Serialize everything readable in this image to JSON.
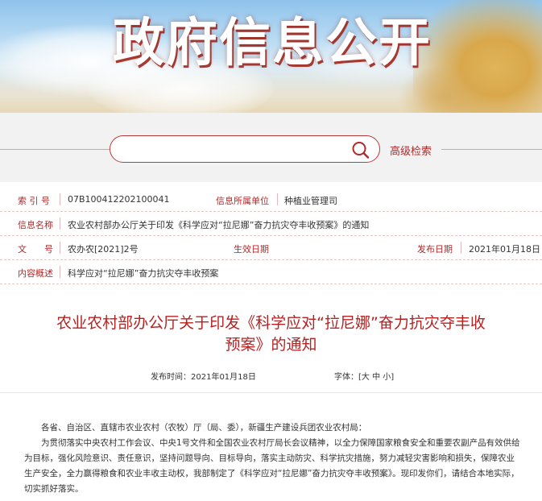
{
  "banner": {
    "title": "政府信息公开"
  },
  "search": {
    "placeholder": "",
    "advanced_label": "高级检索"
  },
  "info": {
    "index_label": "索 引 号",
    "index_value": "07B100412202100041",
    "dept_label": "信息所属单位",
    "dept_value": "种植业管理司",
    "name_label": "信息名称",
    "name_value": "农业农村部办公厅关于印发《科学应对“拉尼娜”奋力抗灾夺丰收预案》的通知",
    "docno_label": "文　　号",
    "docno_value": "农办农[2021]2号",
    "effective_label": "生效日期",
    "effective_value": "",
    "publish_label": "发布日期",
    "publish_value": "2021年01月18日",
    "summary_label": "内容概述",
    "summary_value": "科学应对“拉尼娜”奋力抗灾夺丰收预案"
  },
  "article": {
    "title_line1": "农业农村部办公厅关于印发《科学应对“拉尼娜”奋力抗灾夺丰收",
    "title_line2": "预案》的通知",
    "publish_time": "发布时间：2021年01月18日",
    "font_size_label": "字体：[大 中 小]",
    "para1": "各省、自治区、直辖市农业农村（农牧）厅（局、委），新疆生产建设兵团农业农村局：",
    "para2": "为贯彻落实中央农村工作会议、中央1号文件和全国农业农村厅局长会议精神，以全力保障国家粮食安全和重要农副产品有效供给为目标，强化风险意识、责任意识，坚持问题导向、目标导向，落实主动防灾、科学抗灾措施，努力减轻灾害影响和损失，保障农业生产安全，全力赢得粮食和农业丰收主动权，我部制定了《科学应对“拉尼娜”奋力抗灾夺丰收预案》。现印发你们，请结合本地实际，切实抓好落实。"
  },
  "colors": {
    "accent": "#b02a2a",
    "title_red": "#b52222"
  }
}
